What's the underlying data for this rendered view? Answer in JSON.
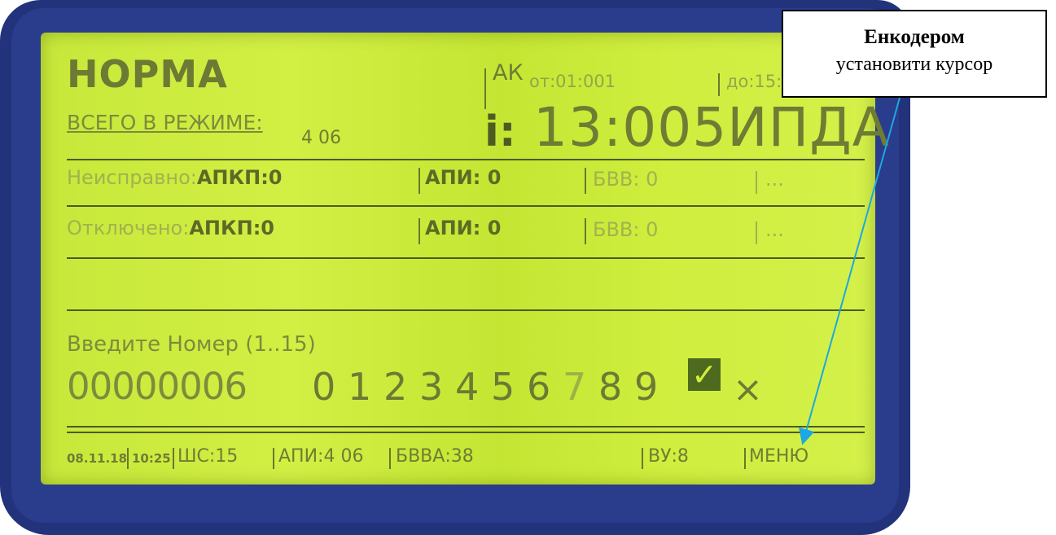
{
  "lcd": {
    "mode": "НОРМА",
    "total_label": "ВСЕГО В РЕЖИМЕ:",
    "total_value": "4 06",
    "ak_label": "АК",
    "from_label": "от:01:001",
    "to_label": "до:15:15",
    "i_label": "i:",
    "i_value": "13:005ИПДА",
    "faulty": {
      "label": "Неисправно:",
      "apkp": "АПКП:0",
      "api": "АПИ: 0",
      "bvv": "БВВ: 0",
      "more": "..."
    },
    "disabled": {
      "label": "Отключено:",
      "apkp": "АПКП:0",
      "api": "АПИ: 0",
      "bvv": "БВВ: 0",
      "more": "..."
    },
    "prompt": "Введите Номер (1..15)",
    "input_value": "00000006",
    "digits": [
      "0",
      "1",
      "2",
      "3",
      "4",
      "5",
      "6",
      "7",
      "8",
      "9"
    ],
    "confirm_symbol": "✓",
    "cancel_symbol": "×"
  },
  "status_bar": {
    "date": "08.11.18",
    "time": "10:25",
    "shs": "ШС:15",
    "api": "АПИ:4 06",
    "bvva": "БВВА:38",
    "vu": "ВУ:8",
    "menu": "МЕНЮ"
  },
  "callout": {
    "title": "Енкодером",
    "text": "установити курсор"
  },
  "colors": {
    "bezel": "#22337c",
    "lcd_background": "#cbea3e",
    "lcd_text": "#5f6f2d",
    "arrow": "#1ea7e0"
  }
}
